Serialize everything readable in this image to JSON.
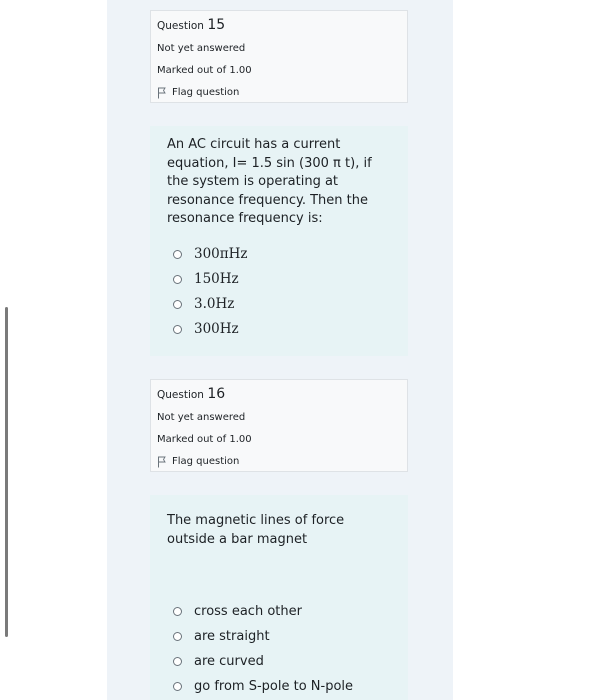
{
  "q15": {
    "info": {
      "question_word": "Question",
      "number": "15",
      "state": "Not yet answered",
      "grade": "Marked out of 1.00",
      "flag_label": "Flag question"
    },
    "text": "An AC circuit has a current equation, I= 1.5 sin (300 π t), if the system is operating at resonance frequency. Then the resonance frequency is:",
    "options": [
      "300πHz",
      "150Hz",
      "3.0Hz",
      "300Hz"
    ]
  },
  "q16": {
    "info": {
      "question_word": "Question",
      "number": "16",
      "state": "Not yet answered",
      "grade": "Marked out of 1.00",
      "flag_label": "Flag question"
    },
    "text": "The magnetic lines of force outside a bar magnet",
    "options": [
      "cross each other",
      "are straight",
      "are curved",
      "go from S-pole to N-pole"
    ]
  }
}
